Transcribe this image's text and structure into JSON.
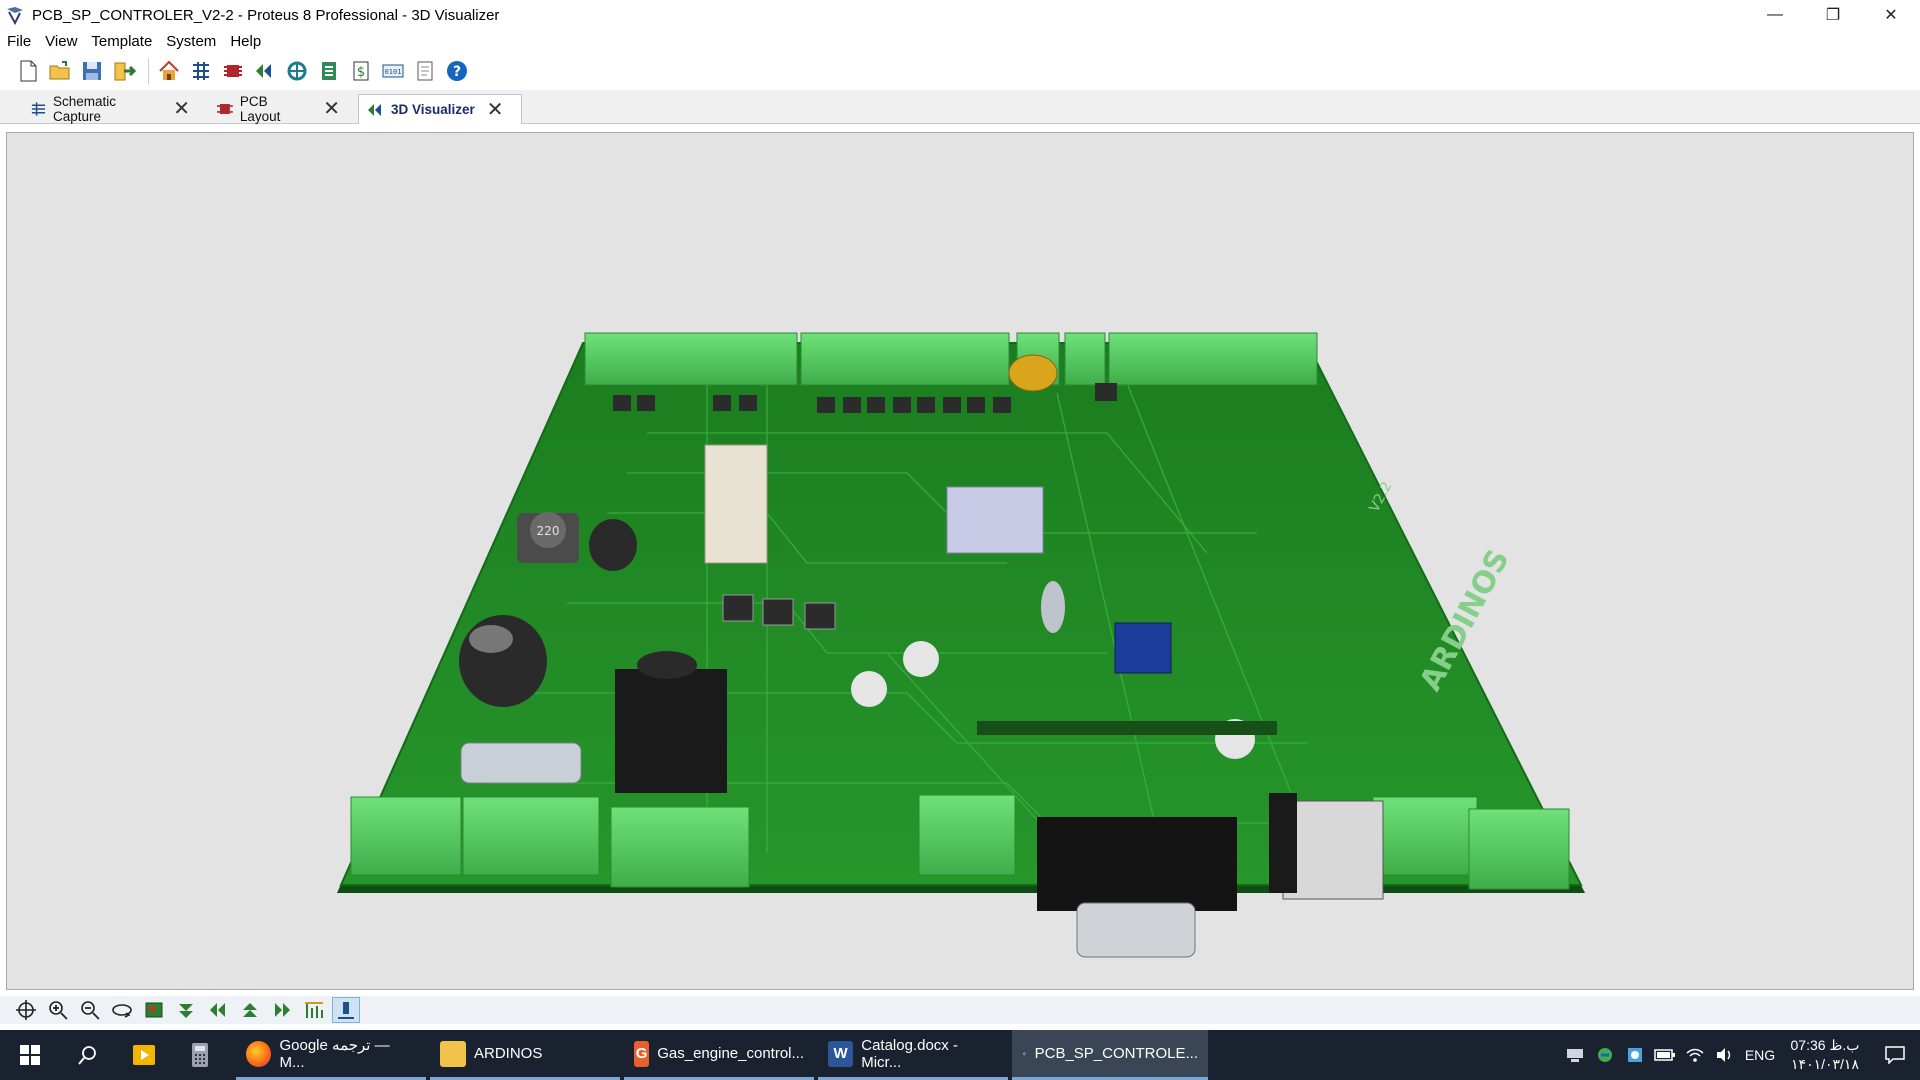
{
  "window": {
    "title": "PCB_SP_CONTROLER_V2-2 - Proteus 8 Professional - 3D Visualizer",
    "minimize": "—",
    "restore": "❐",
    "close": "✕"
  },
  "menu": [
    "File",
    "View",
    "Template",
    "System",
    "Help"
  ],
  "toolbar": [
    "new-file",
    "open-folder",
    "save",
    "import",
    "home",
    "schematic",
    "pcb",
    "3d-visualizer",
    "gerber-viewer",
    "bom",
    "design-explorer",
    "vsm-studio",
    "notes",
    "help"
  ],
  "tabs": [
    {
      "label": "Schematic Capture",
      "close": "✕"
    },
    {
      "label": "PCB Layout",
      "close": "✕"
    },
    {
      "label": "3D Visualizer",
      "close": "✕"
    }
  ],
  "board": {
    "inductor_marking": "220",
    "silkscreen_text": "ARDINOS",
    "silkscreen_version": "V2.2",
    "colors": {
      "board": "#1f8a22",
      "board_edge": "#0f4d12",
      "terminal": "#5fd36a",
      "background": "#e3e3e3"
    }
  },
  "navbar": [
    "pan",
    "zoom-in",
    "zoom-out",
    "rotate",
    "board-view",
    "view-top",
    "view-front",
    "view-left",
    "view-right",
    "show-height",
    "show-components"
  ],
  "taskbar": {
    "apps": [
      {
        "label": "Google ترجمه — M...",
        "icon": "firefox-icon"
      },
      {
        "label": "ARDINOS",
        "icon": "folder-icon"
      },
      {
        "label": "Gas_engine_control...",
        "icon": "pdf-icon"
      },
      {
        "label": "Catalog.docx - Micr...",
        "icon": "word-icon"
      },
      {
        "label": "PCB_SP_CONTROLE...",
        "icon": "proteus-icon"
      }
    ],
    "lang": "ENG",
    "time": "07:36 ب.ظ",
    "date": "۱۴۰۱/۰۳/۱۸"
  }
}
